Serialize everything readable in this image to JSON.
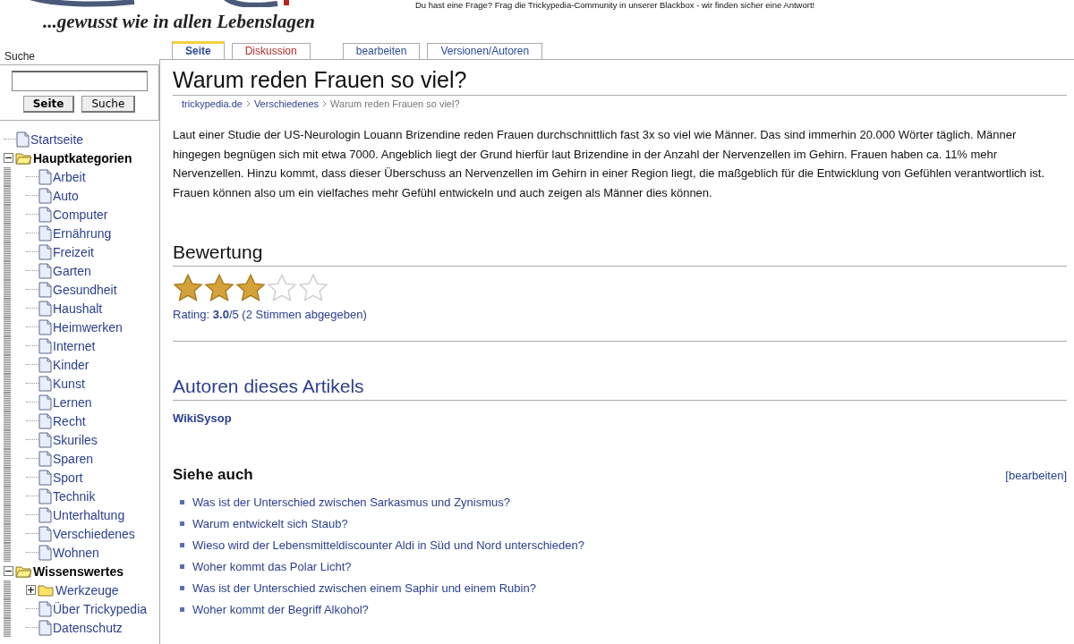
{
  "header": {
    "tagline": "...gewusst wie in allen Lebenslagen",
    "notice": "Du hast eine Frage? Frag die Trickypedia-Community in unserer Blackbox - wir finden sicher eine Antwort!"
  },
  "sidebar": {
    "search_label": "Suche",
    "buttons": [
      "Seite",
      "Suche"
    ],
    "tree": [
      {
        "label": "Startseite",
        "kind": "page"
      },
      {
        "label": "Hauptkategorien",
        "kind": "folder",
        "expanded": true,
        "children": [
          {
            "label": "Arbeit",
            "kind": "page"
          },
          {
            "label": "Auto",
            "kind": "page"
          },
          {
            "label": "Computer",
            "kind": "page"
          },
          {
            "label": "Ernährung",
            "kind": "page"
          },
          {
            "label": "Freizeit",
            "kind": "page"
          },
          {
            "label": "Garten",
            "kind": "page"
          },
          {
            "label": "Gesundheit",
            "kind": "page"
          },
          {
            "label": "Haushalt",
            "kind": "page"
          },
          {
            "label": "Heimwerken",
            "kind": "page"
          },
          {
            "label": "Internet",
            "kind": "page"
          },
          {
            "label": "Kinder",
            "kind": "page"
          },
          {
            "label": "Kunst",
            "kind": "page"
          },
          {
            "label": "Lernen",
            "kind": "page"
          },
          {
            "label": "Recht",
            "kind": "page"
          },
          {
            "label": "Skuriles",
            "kind": "page"
          },
          {
            "label": "Sparen",
            "kind": "page"
          },
          {
            "label": "Sport",
            "kind": "page"
          },
          {
            "label": "Technik",
            "kind": "page"
          },
          {
            "label": "Unterhaltung",
            "kind": "page"
          },
          {
            "label": "Verschiedenes",
            "kind": "page"
          },
          {
            "label": "Wohnen",
            "kind": "page"
          }
        ]
      },
      {
        "label": "Wissenswertes",
        "kind": "folder",
        "expanded": true,
        "children": [
          {
            "label": "Werkzeuge",
            "kind": "folder",
            "expanded": false
          },
          {
            "label": "Über Trickypedia",
            "kind": "page"
          },
          {
            "label": "Datenschutz",
            "kind": "page"
          }
        ]
      }
    ]
  },
  "tabs": [
    {
      "label": "Seite",
      "selected": true,
      "missing": false
    },
    {
      "label": "Diskussion",
      "selected": false,
      "missing": true
    },
    {
      "label": "bearbeiten",
      "selected": false,
      "missing": false
    },
    {
      "label": "Versionen/Autoren",
      "selected": false,
      "missing": false
    }
  ],
  "article": {
    "title": "Warum reden Frauen so viel?",
    "breadcrumb": [
      {
        "label": "trickypedia.de",
        "link": true
      },
      {
        "label": "Verschiedenes",
        "link": true
      },
      {
        "label": "Warum reden Frauen so viel?",
        "link": false
      }
    ],
    "body": "Laut einer Studie der US-Neurologin Louann Brizendine reden Frauen durchschnittlich fast 3x so viel wie Männer. Das sind immerhin 20.000 Wörter täglich. Männer hingegen begnügen sich mit etwa 7000. Angeblich liegt der Grund hierfür laut Brizendine in der Anzahl der Nervenzellen im Gehirn. Frauen haben ca. 11% mehr Nervenzellen. Hinzu kommt, dass dieser Überschuss an Nervenzellen im Gehirn in einer Region liegt, die maßgeblich für die Entwicklung von Gefühlen verantwortlich ist. Frauen können also um ein vielfaches mehr Gefühl entwickeln und auch zeigen als Männer dies können.",
    "rating": {
      "heading": "Bewertung",
      "stars": 3,
      "text": "Rating: **3.0**/5 (2 Stimmen abgegeben)"
    },
    "authors": {
      "heading": "Autoren dieses Artikels",
      "names": [
        "WikiSysop"
      ]
    },
    "see_also": {
      "heading": "Siehe auch",
      "edit": "[bearbeiten]",
      "links": [
        "Was ist der Unterschied zwischen Sarkasmus und Zynismus?",
        "Warum entwickelt sich Staub?",
        "Wieso wird der Lebensmitteldiscounter Aldi in Süd und Nord unterschieden?",
        "Woher kommt das Polar Licht?",
        "Was ist der Unterschied zwischen einem Saphir und einem Rubin?",
        "Woher kommt der Begriff Alkohol?"
      ]
    }
  }
}
